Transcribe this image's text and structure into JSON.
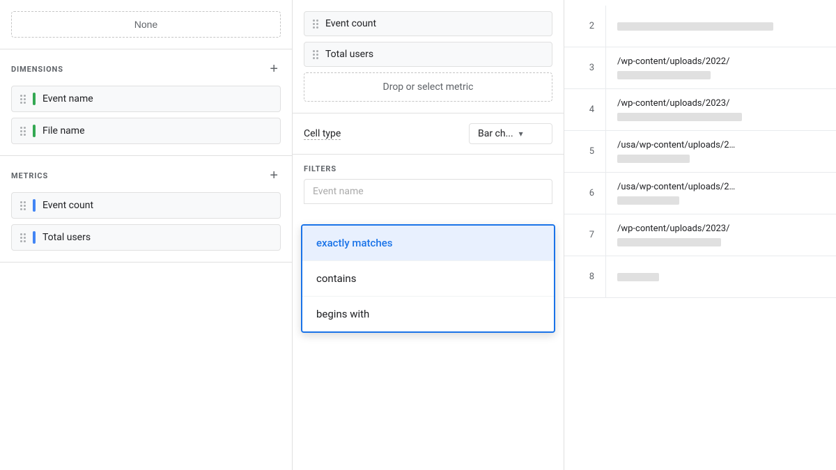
{
  "leftPanel": {
    "noneButton": "None",
    "dimensionsSection": {
      "title": "DIMENSIONS",
      "addButtonLabel": "+",
      "items": [
        {
          "label": "Event name",
          "color": "#34a853"
        },
        {
          "label": "File name",
          "color": "#34a853"
        }
      ]
    },
    "metricsSection": {
      "title": "METRICS",
      "addButtonLabel": "+",
      "items": [
        {
          "label": "Event count",
          "color": "#4285f4"
        },
        {
          "label": "Total users",
          "color": "#4285f4"
        }
      ]
    }
  },
  "middlePanel": {
    "metrics": [
      {
        "label": "Event count"
      },
      {
        "label": "Total users"
      }
    ],
    "dropMetricPlaceholder": "Drop or select metric",
    "cellType": {
      "label": "Cell type",
      "value": "Bar ch..."
    },
    "filtersSection": {
      "title": "FILTERS",
      "filterInputPlaceholder": "Event name"
    },
    "dropdown": {
      "items": [
        {
          "label": "exactly matches",
          "selected": true
        },
        {
          "label": "contains",
          "selected": false
        },
        {
          "label": "begins with",
          "selected": false
        }
      ],
      "scrollbarVisible": true
    }
  },
  "rightPanel": {
    "rows": [
      {
        "number": "2",
        "url": "",
        "barWidth": "75"
      },
      {
        "number": "3",
        "url": "/wp-content/uploads/2022/",
        "barWidth": "45"
      },
      {
        "number": "4",
        "url": "/wp-content/uploads/2023/",
        "barWidth": "60"
      },
      {
        "number": "5",
        "url": "/usa/wp-content/uploads/2…",
        "barWidth": "35"
      },
      {
        "number": "6",
        "url": "/usa/wp-content/uploads/2…",
        "barWidth": "30"
      },
      {
        "number": "7",
        "url": "/wp-content/uploads/2023/",
        "barWidth": "50"
      },
      {
        "number": "8",
        "url": "",
        "barWidth": "20"
      }
    ]
  },
  "icons": {
    "drag": "⠿",
    "chevronDown": "▾",
    "plus": "+"
  }
}
